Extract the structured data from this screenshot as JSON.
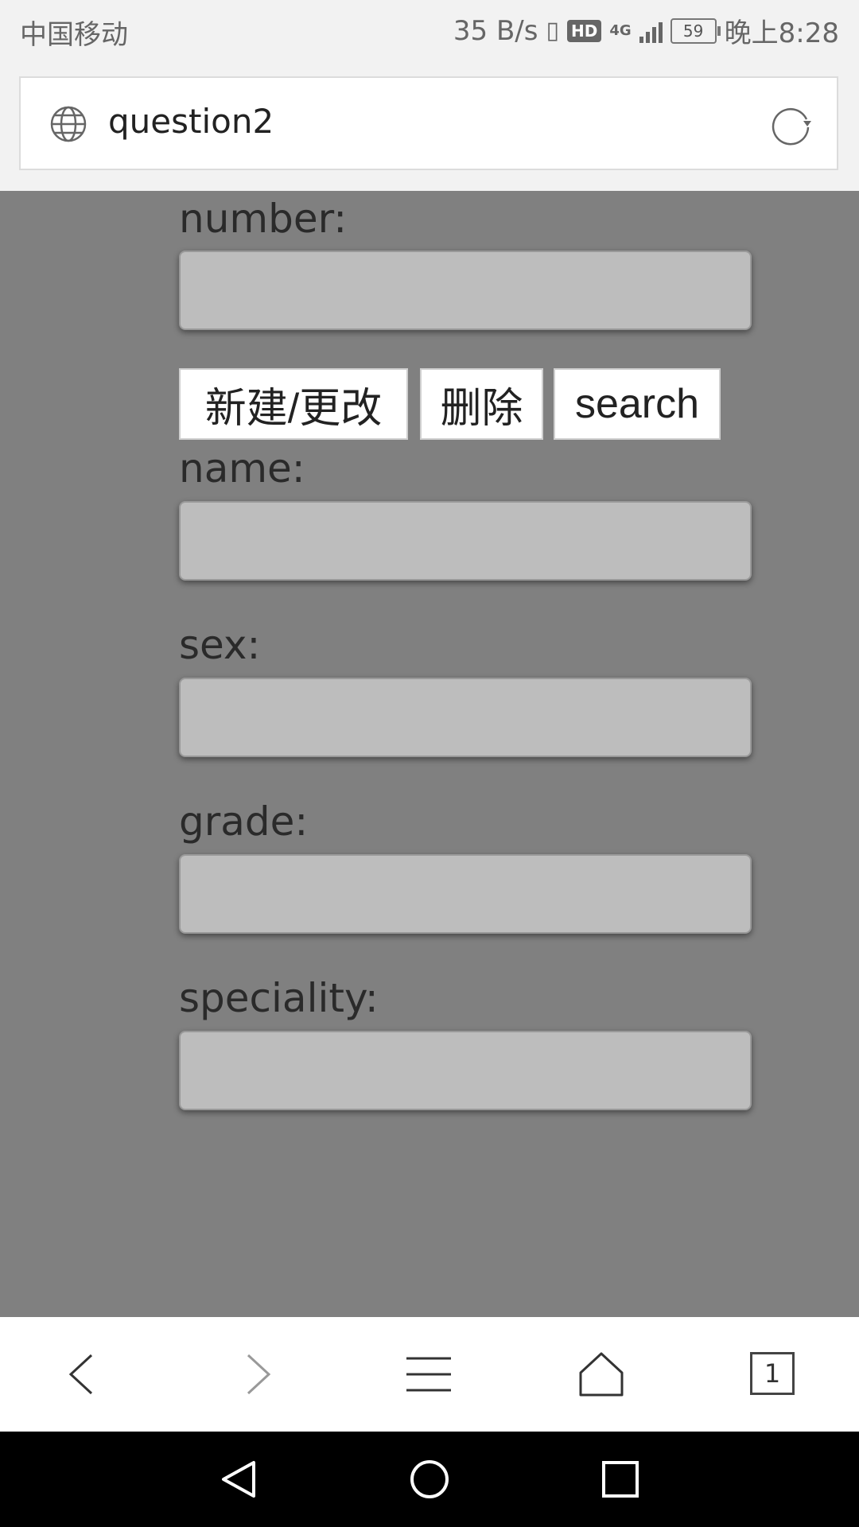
{
  "status_bar": {
    "carrier": "中国移动",
    "net_speed": "35 B/s",
    "hd_badge": "HD",
    "network_type": "4G",
    "battery": "59",
    "time": "晚上8:28"
  },
  "address_bar": {
    "page_title": "question2"
  },
  "form": {
    "number_label": "number:",
    "name_label": "name:",
    "sex_label": "sex:",
    "grade_label": "grade:",
    "speciality_label": "speciality:",
    "buttons": {
      "create_update": "新建/更改",
      "delete": "删除",
      "search": "search"
    }
  },
  "toolbar": {
    "tab_count": "1"
  },
  "colors": {
    "page_background": "#808080",
    "field_background": "#bdbdbd"
  }
}
